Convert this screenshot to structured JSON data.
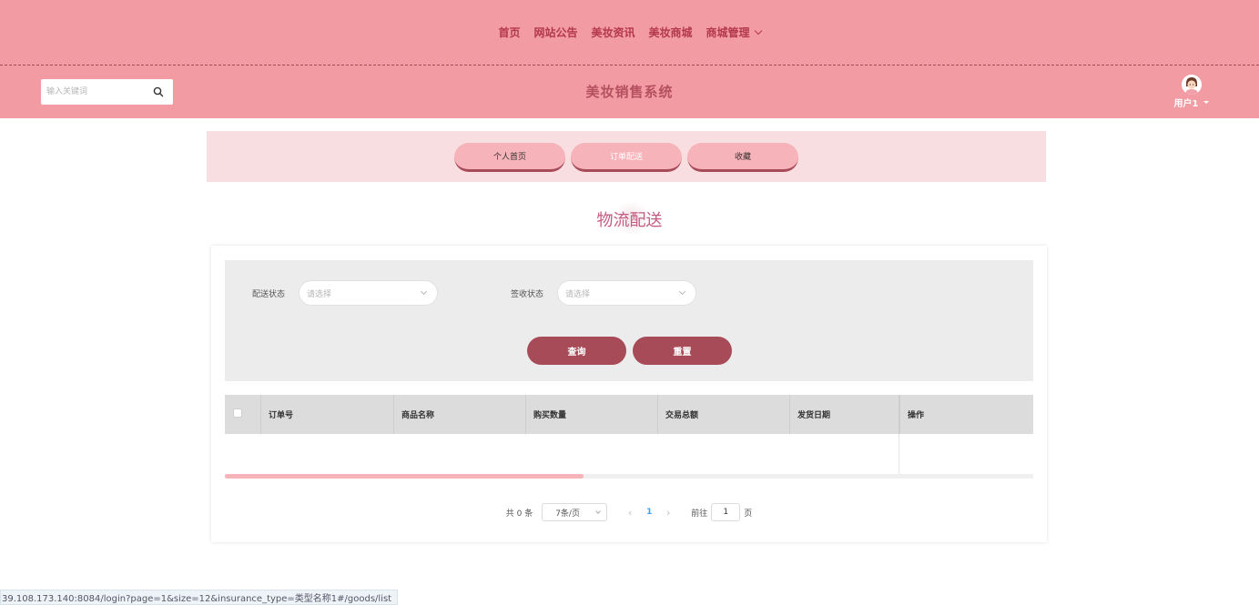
{
  "nav": {
    "items": [
      {
        "label": "首页"
      },
      {
        "label": "网站公告"
      },
      {
        "label": "美妆资讯"
      },
      {
        "label": "美妆商城"
      },
      {
        "label": "商城管理",
        "has_dropdown": true
      }
    ]
  },
  "header": {
    "search_placeholder": "输入关键词",
    "title": "美妆销售系统",
    "user_name": "用户1"
  },
  "tabs": [
    {
      "label": "个人首页",
      "active": false
    },
    {
      "label": "订单配送",
      "active": true
    },
    {
      "label": "收藏",
      "active": false
    }
  ],
  "page": {
    "heading": "物流配送"
  },
  "filters": {
    "delivery_status": {
      "label": "配送状态",
      "placeholder": "请选择"
    },
    "sign_status": {
      "label": "签收状态",
      "placeholder": "请选择"
    },
    "query_label": "查询",
    "reset_label": "重置"
  },
  "table": {
    "columns": [
      "订单号",
      "商品名称",
      "购买数量",
      "交易总额",
      "发货日期",
      "操作"
    ],
    "rows": []
  },
  "pagination": {
    "total_text": "共 0 条",
    "page_size": "7条/页",
    "prev": "‹",
    "current_page": "1",
    "next": "›",
    "goto_label": "前往",
    "goto_value": "1",
    "page_suffix": "页"
  },
  "status_bar": {
    "url": "39.108.173.140:8084/login?page=1&size=12&insurance_type=类型名称1#/goods/list"
  },
  "colors": {
    "header_bg": "#f39ba2",
    "nav_text": "#b3384a",
    "accent": "#a84b58",
    "heading": "#c45a82",
    "tab_bg": "#f7b3ba"
  }
}
